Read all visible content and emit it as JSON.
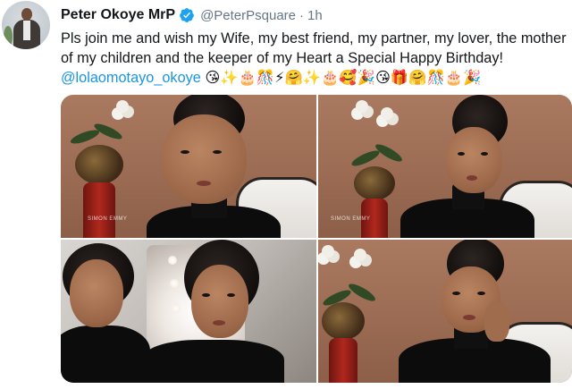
{
  "tweet": {
    "display_name": "Peter Okoye MrP",
    "handle": "@PeterPsquare",
    "separator": "·",
    "time": "1h",
    "text": "Pls join me and wish my Wife, my best friend, my partner, my lover, the mother of my children and the keeper of my Heart a Special Happy Birthday!",
    "mention": "@lolaomotayo_okoye",
    "emojis": "😘✨🎂🎊⚡🤗✨🎂🥰🎉😘🎁🤗🎊🎂🎉"
  },
  "media": {
    "photos": [
      {
        "watermark": "SIMON EMMY"
      },
      {
        "watermark": "SIMON EMMY"
      },
      {
        "watermark": ""
      },
      {
        "watermark": ""
      }
    ]
  },
  "icons": {
    "verified": "verified-badge-icon"
  },
  "colors": {
    "link": "#1b95e0",
    "secondary_text": "#657786",
    "verified": "#1da1f2",
    "primary_text": "#14171a"
  }
}
